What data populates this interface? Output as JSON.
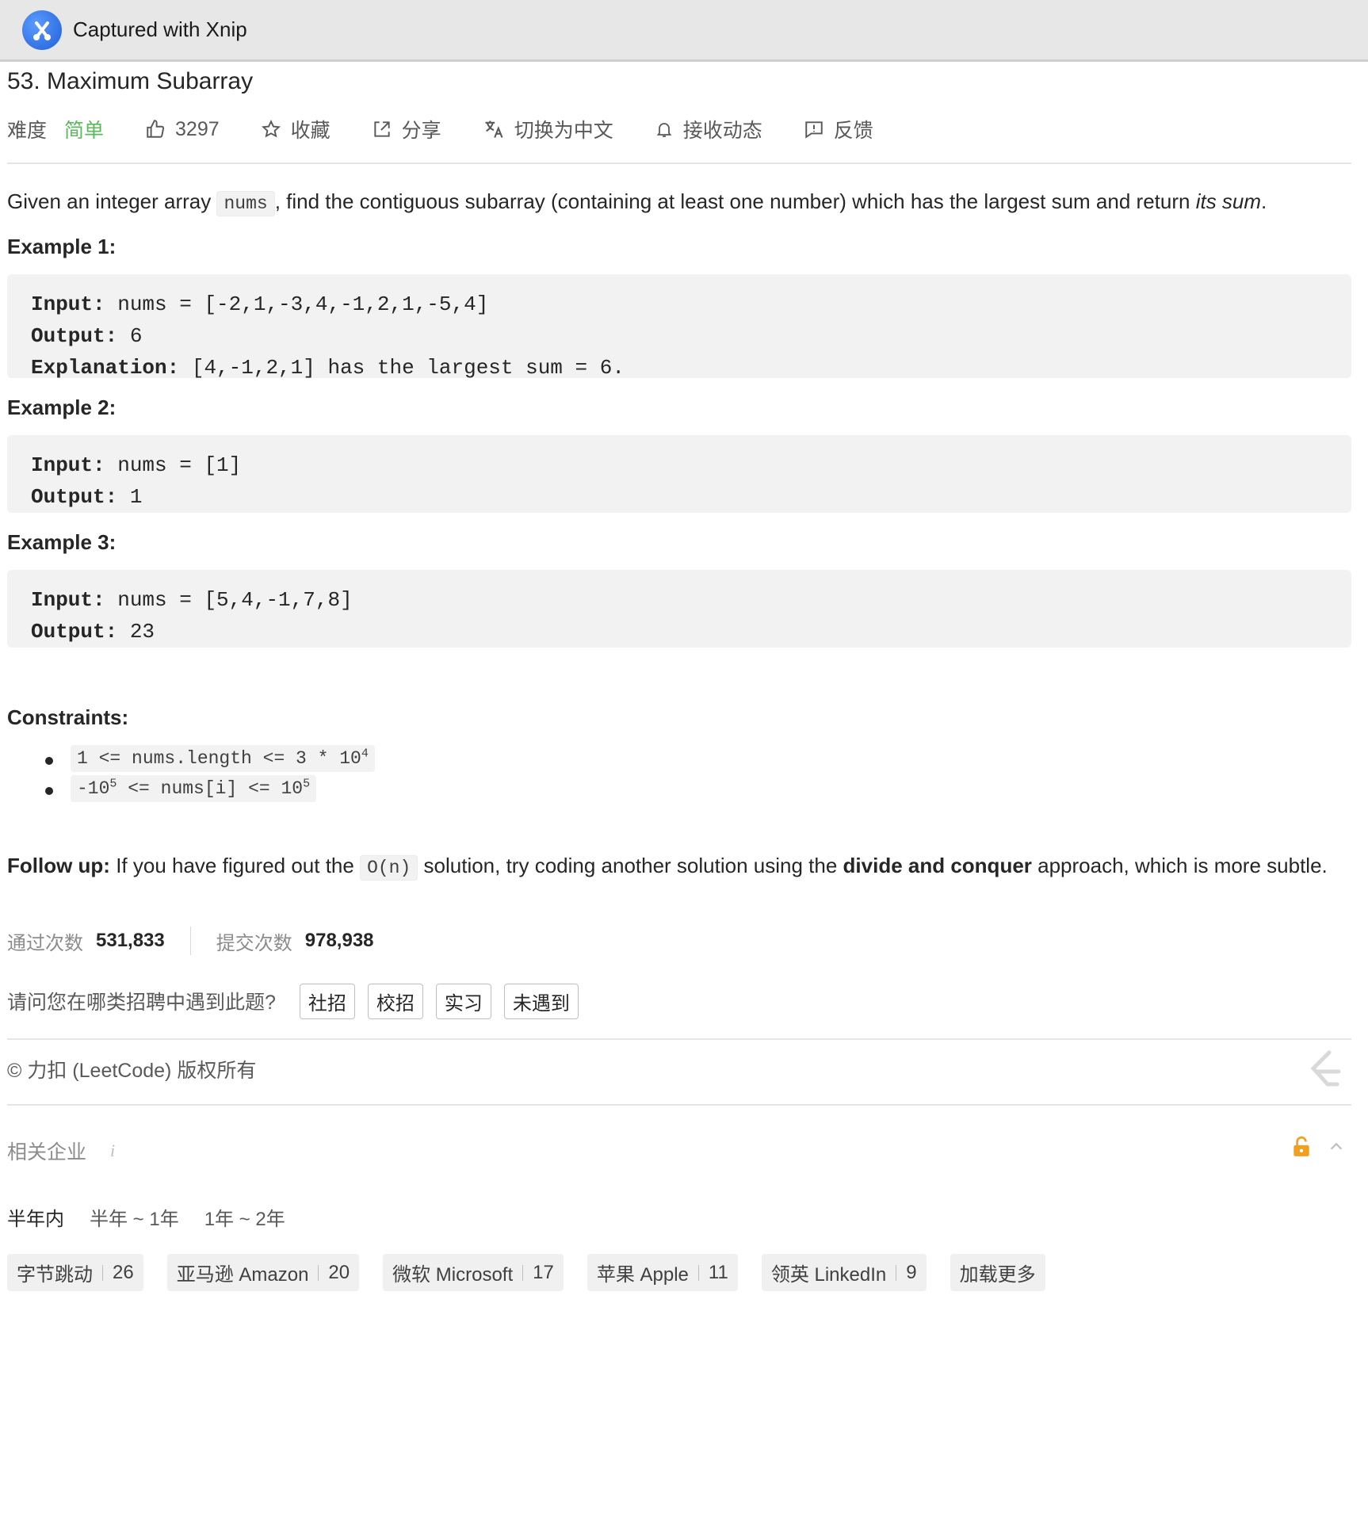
{
  "app": {
    "title": "Captured with Xnip"
  },
  "problem": {
    "title": "53. Maximum Subarray",
    "difficulty_label": "难度",
    "difficulty": "简单",
    "likes": "3297",
    "actions": {
      "favorite": "收藏",
      "share": "分享",
      "switch_lang": "切换为中文",
      "subscribe": "接收动态",
      "feedback": "反馈"
    },
    "description": {
      "part1": "Given an integer array ",
      "code": "nums",
      "part2": ", find the contiguous subarray (containing at least one number) which has the largest sum and return ",
      "em": "its sum",
      "part3": "."
    }
  },
  "examples": [
    {
      "heading": "Example 1:",
      "input_label": "Input:",
      "input": " nums = [-2,1,-3,4,-1,2,1,-5,4]",
      "output_label": "Output:",
      "output": " 6",
      "explanation_label": "Explanation:",
      "explanation": " [4,-1,2,1] has the largest sum = 6."
    },
    {
      "heading": "Example 2:",
      "input_label": "Input:",
      "input": " nums = [1]",
      "output_label": "Output:",
      "output": " 1"
    },
    {
      "heading": "Example 3:",
      "input_label": "Input:",
      "input": " nums = [5,4,-1,7,8]",
      "output_label": "Output:",
      "output": " 23"
    }
  ],
  "constraints": {
    "heading": "Constraints:",
    "c1_base": "1 <= nums.length <= 3 * 10",
    "c1_exp": "4",
    "c2_a": "-10",
    "c2_a_exp": "5",
    "c2_mid": " <= nums[i] <= 10",
    "c2_b_exp": "5"
  },
  "followup": {
    "label": "Follow up:",
    "part1": " If you have figured out the ",
    "code": "O(n)",
    "part2": " solution, try coding another solution using the ",
    "bold": "divide and conquer",
    "part3": " approach, which is more subtle."
  },
  "stats": {
    "accepted_label": "通过次数",
    "accepted": "531,833",
    "submissions_label": "提交次数",
    "submissions": "978,938"
  },
  "hiring": {
    "question": "请问您在哪类招聘中遇到此题?",
    "options": [
      "社招",
      "校招",
      "实习",
      "未遇到"
    ]
  },
  "copyright": "© 力扣 (LeetCode) 版权所有",
  "companies": {
    "heading": "相关企业",
    "info": "i",
    "time_tabs": [
      "半年内",
      "半年 ~ 1年",
      "1年 ~ 2年"
    ],
    "tags": [
      {
        "name": "字节跳动",
        "count": "26"
      },
      {
        "name": "亚马逊 Amazon",
        "count": "20"
      },
      {
        "name": "微软 Microsoft",
        "count": "17"
      },
      {
        "name": "苹果 Apple",
        "count": "11"
      },
      {
        "name": "领英 LinkedIn",
        "count": "9"
      }
    ],
    "load_more": "加载更多"
  },
  "colors": {
    "difficulty_easy": "#5cb85c",
    "lock_orange": "#f0a020",
    "code_bg": "#f2f2f2"
  },
  "icons": [
    "xnip-logo",
    "thumbs-up-icon",
    "star-icon",
    "share-icon",
    "translate-icon",
    "bell-icon",
    "feedback-icon",
    "leetcode-logo",
    "lock-icon",
    "chevron-up-icon"
  ]
}
